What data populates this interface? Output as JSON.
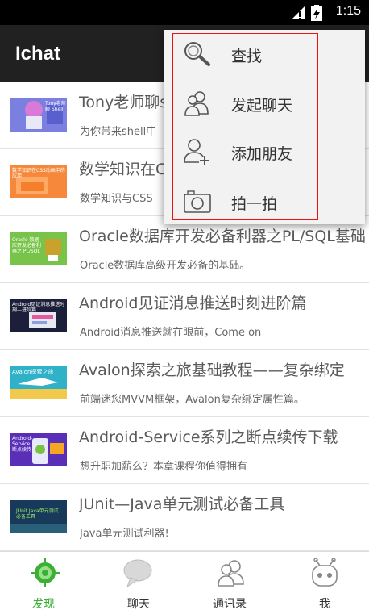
{
  "status_bar": {
    "time": "1:15",
    "signal_icon": "signal-icon",
    "battery_icon": "battery-icon"
  },
  "app_bar": {
    "title": "Ichat"
  },
  "popup_menu": {
    "items": [
      {
        "label": "查找",
        "icon": "search-icon"
      },
      {
        "label": "发起聊天",
        "icon": "contacts-icon"
      },
      {
        "label": "添加朋友",
        "icon": "add-friend-icon"
      },
      {
        "label": "拍一拍",
        "icon": "camera-icon"
      }
    ]
  },
  "course_list": {
    "items": [
      {
        "title": "Tony老师聊shell",
        "desc": "为你带来shell中",
        "thumb_caption": "Tony老师聊 Shell"
      },
      {
        "title": "数学知识在CSS",
        "desc": "数学知识与CSS",
        "thumb_caption": "数学知识在CSS动画中的应用"
      },
      {
        "title": "Oracle数据库开发必备利器之PL/SQL基础",
        "desc": "Oracle数据库高级开发必备的基础。",
        "thumb_caption": "Oracle 数据库开发必备利器之 PL/SQL"
      },
      {
        "title": "Android见证消息推送时刻进阶篇",
        "desc": "Android消息推送就在眼前，Come on",
        "thumb_caption": "Android见证消息推送时刻—进阶篇"
      },
      {
        "title": "Avalon探索之旅基础教程——复杂绑定",
        "desc": "前端迷您MVVM框架，Avalon复杂绑定属性篇。",
        "thumb_caption": "Avalon探索之旅"
      },
      {
        "title": "Android-Service系列之断点续传下载",
        "desc": "想升职加薪么？本章课程你值得拥有",
        "thumb_caption": "Android-Service 断点续传"
      },
      {
        "title": "JUnit—Java单元测试必备工具",
        "desc": "Java单元测试利器!",
        "thumb_caption": "JUnit Java单元测试必备工具"
      }
    ]
  },
  "tab_bar": {
    "tabs": [
      {
        "label": "发现",
        "icon": "discover-icon",
        "active": true
      },
      {
        "label": "聊天",
        "icon": "chat-bubble-icon",
        "active": false
      },
      {
        "label": "通讯录",
        "icon": "contacts-tab-icon",
        "active": false
      },
      {
        "label": "我",
        "icon": "robot-me-icon",
        "active": false
      }
    ]
  },
  "colors": {
    "accent": "#3cb034",
    "app_bar": "#212121",
    "popup_border": "#e11111"
  }
}
